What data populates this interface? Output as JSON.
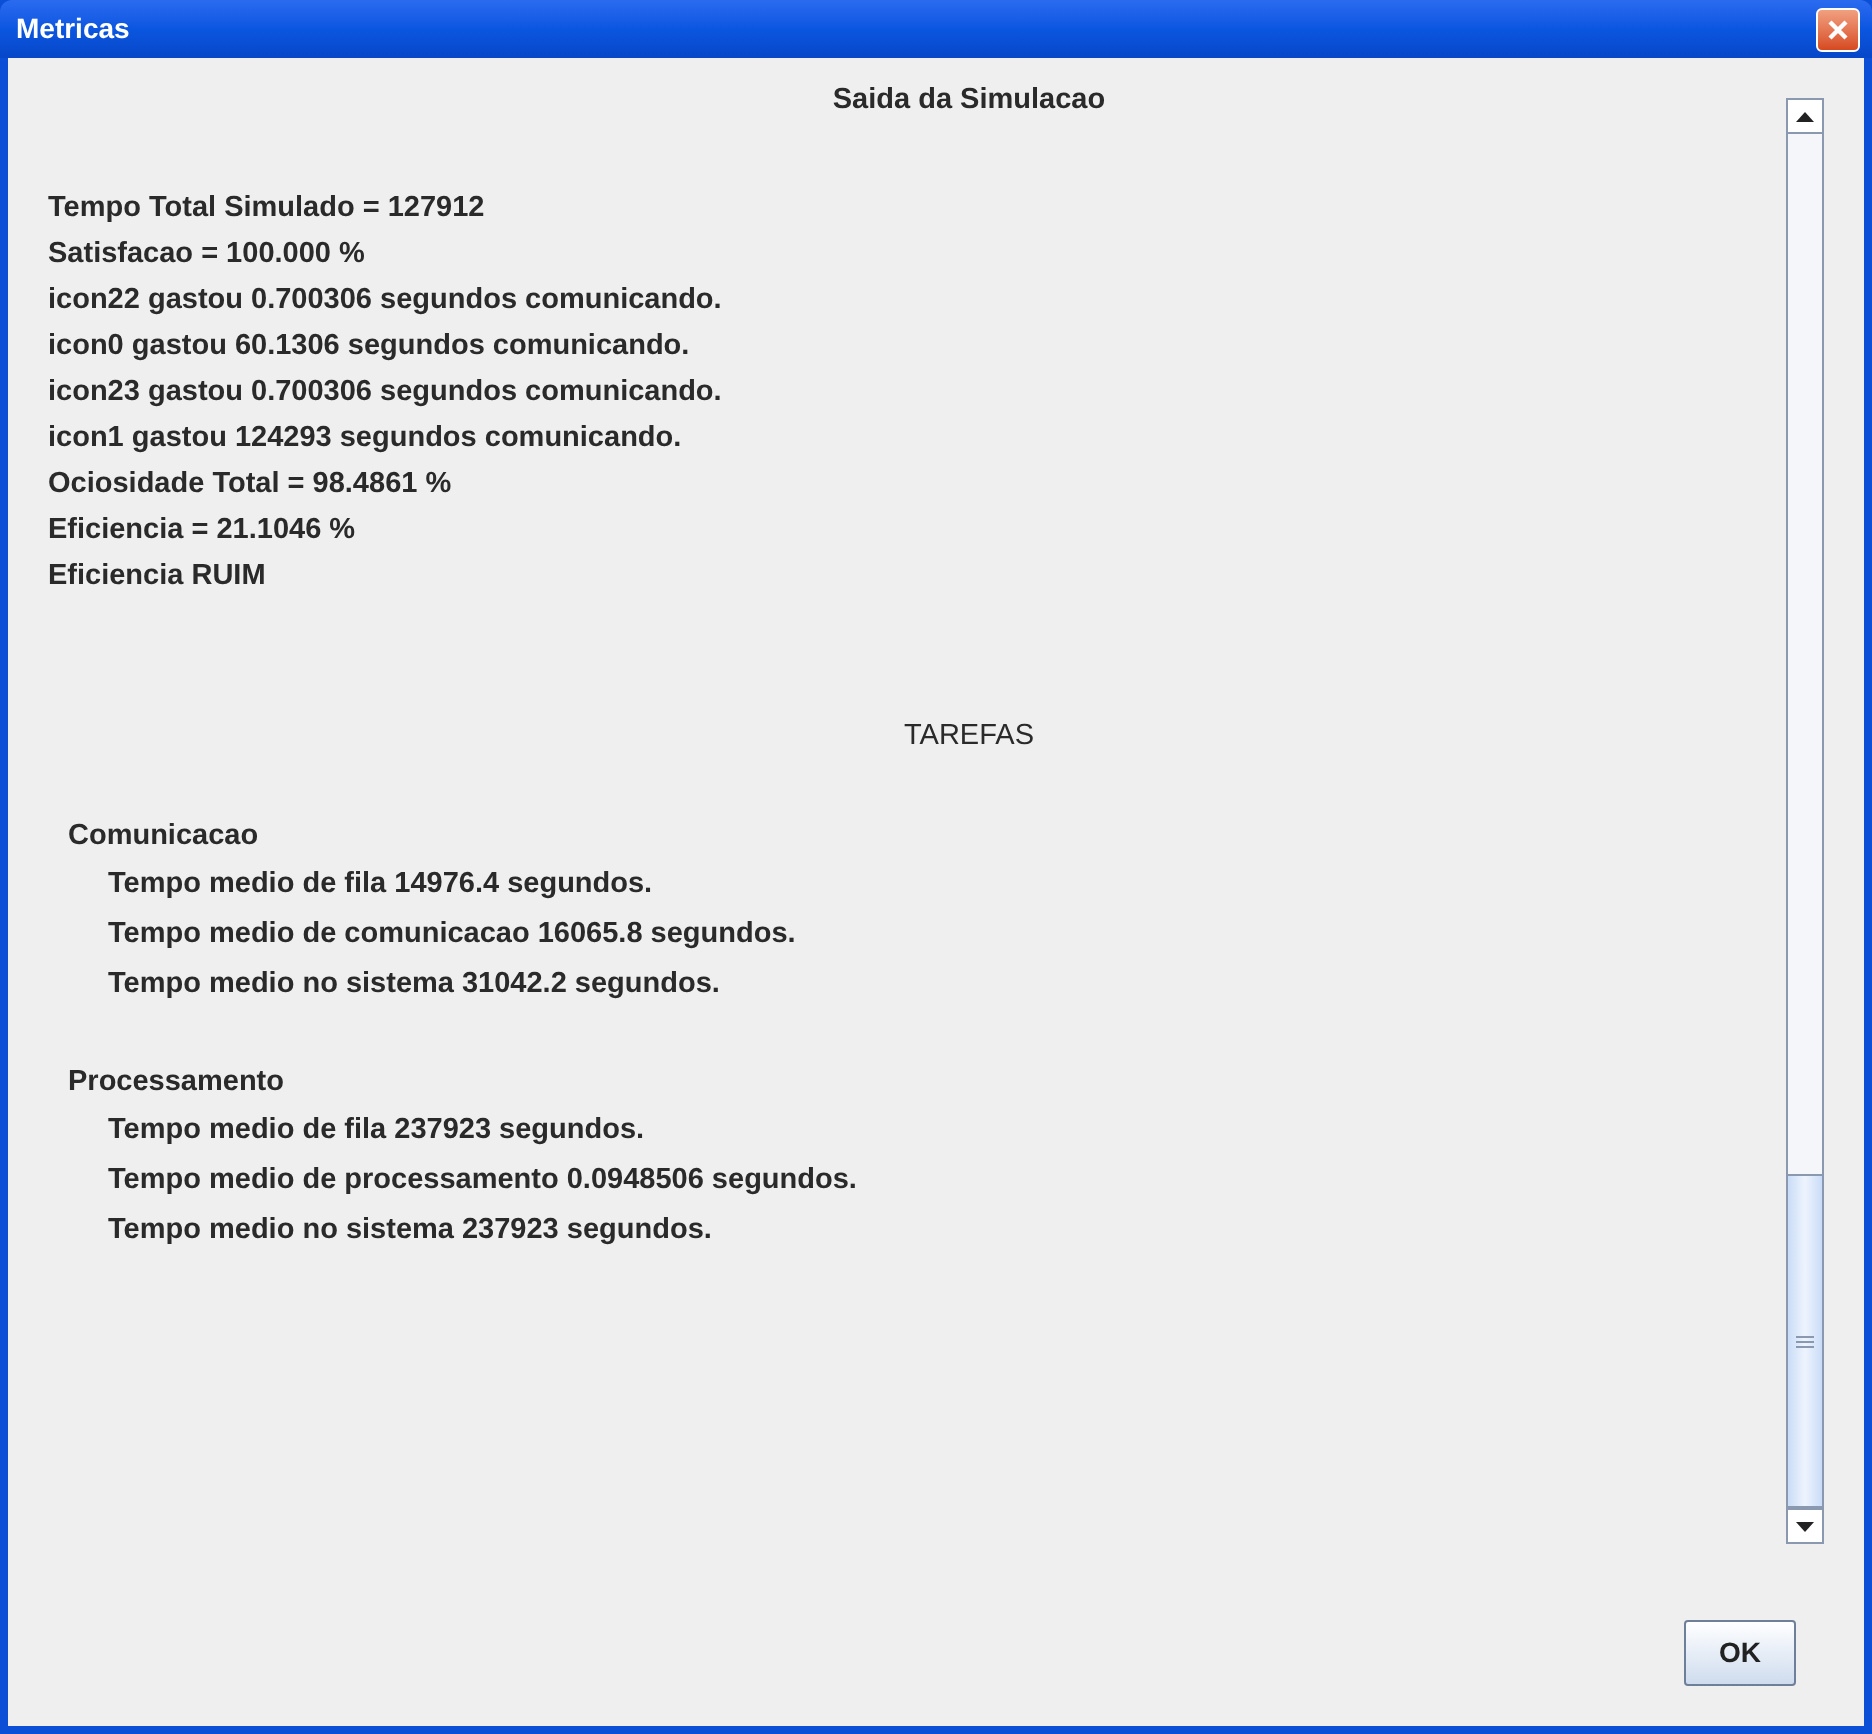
{
  "window": {
    "title": "Metricas"
  },
  "output": {
    "heading": "Saida da Simulacao",
    "lines": [
      "Tempo Total Simulado = 127912",
      "Satisfacao = 100.000 %",
      "icon22 gastou 0.700306 segundos comunicando.",
      "icon0 gastou 60.1306 segundos comunicando.",
      "icon23 gastou 0.700306 segundos comunicando.",
      "icon1 gastou 124293 segundos comunicando.",
      "Ociosidade Total = 98.4861 %",
      "Eficiencia = 21.1046 %",
      "Eficiencia RUIM"
    ],
    "section_heading": "TAREFAS",
    "groups": [
      {
        "name": "Comunicacao",
        "lines": [
          "Tempo medio de fila 14976.4 segundos.",
          "Tempo medio de comunicacao 16065.8 segundos.",
          "Tempo medio no sistema 31042.2 segundos."
        ]
      },
      {
        "name": "Processamento",
        "lines": [
          "Tempo medio de fila 237923 segundos.",
          "Tempo medio de processamento 0.0948506 segundos.",
          "Tempo medio no sistema 237923 segundos."
        ]
      }
    ]
  },
  "ok_button": "OK"
}
